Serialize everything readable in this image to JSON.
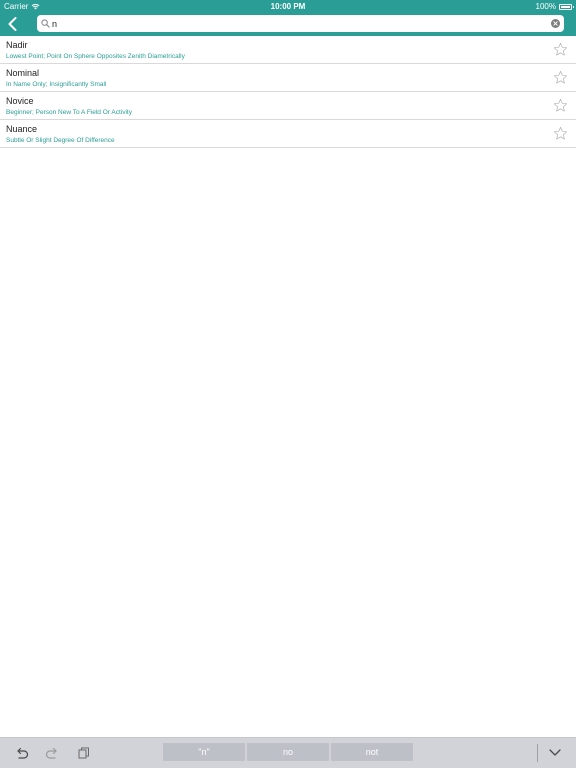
{
  "status_bar": {
    "carrier": "Carrier",
    "time": "10:00 PM",
    "battery": "100%",
    "battery_level": 1.0
  },
  "search": {
    "value": "n",
    "placeholder": ""
  },
  "results": [
    {
      "word": "Nadir",
      "definition": "Lowest Point; Point On Sphere Opposites Zenith Diametrically"
    },
    {
      "word": "Nominal",
      "definition": "In Name Only; Insignificantly Small"
    },
    {
      "word": "Novice",
      "definition": "Beginner; Person New To A Field Or Activity"
    },
    {
      "word": "Nuance",
      "definition": "Subtle Or Slight Degree Of Difference"
    }
  ],
  "keyboard": {
    "suggestions": [
      "\"n\"",
      "no",
      "not"
    ]
  },
  "icons": {
    "back": "chevron-left-icon",
    "search": "search-icon",
    "clear": "clear-icon",
    "favorite": "star-outline-icon",
    "undo": "undo-icon",
    "redo": "redo-icon",
    "paste": "paste-icon",
    "dismiss": "chevron-down-icon"
  },
  "colors": {
    "header": "#2a9d96",
    "definition_text": "#2a9d96",
    "keyboard_bar": "#d1d3d9",
    "suggestion_bg": "#bdc0c7"
  }
}
